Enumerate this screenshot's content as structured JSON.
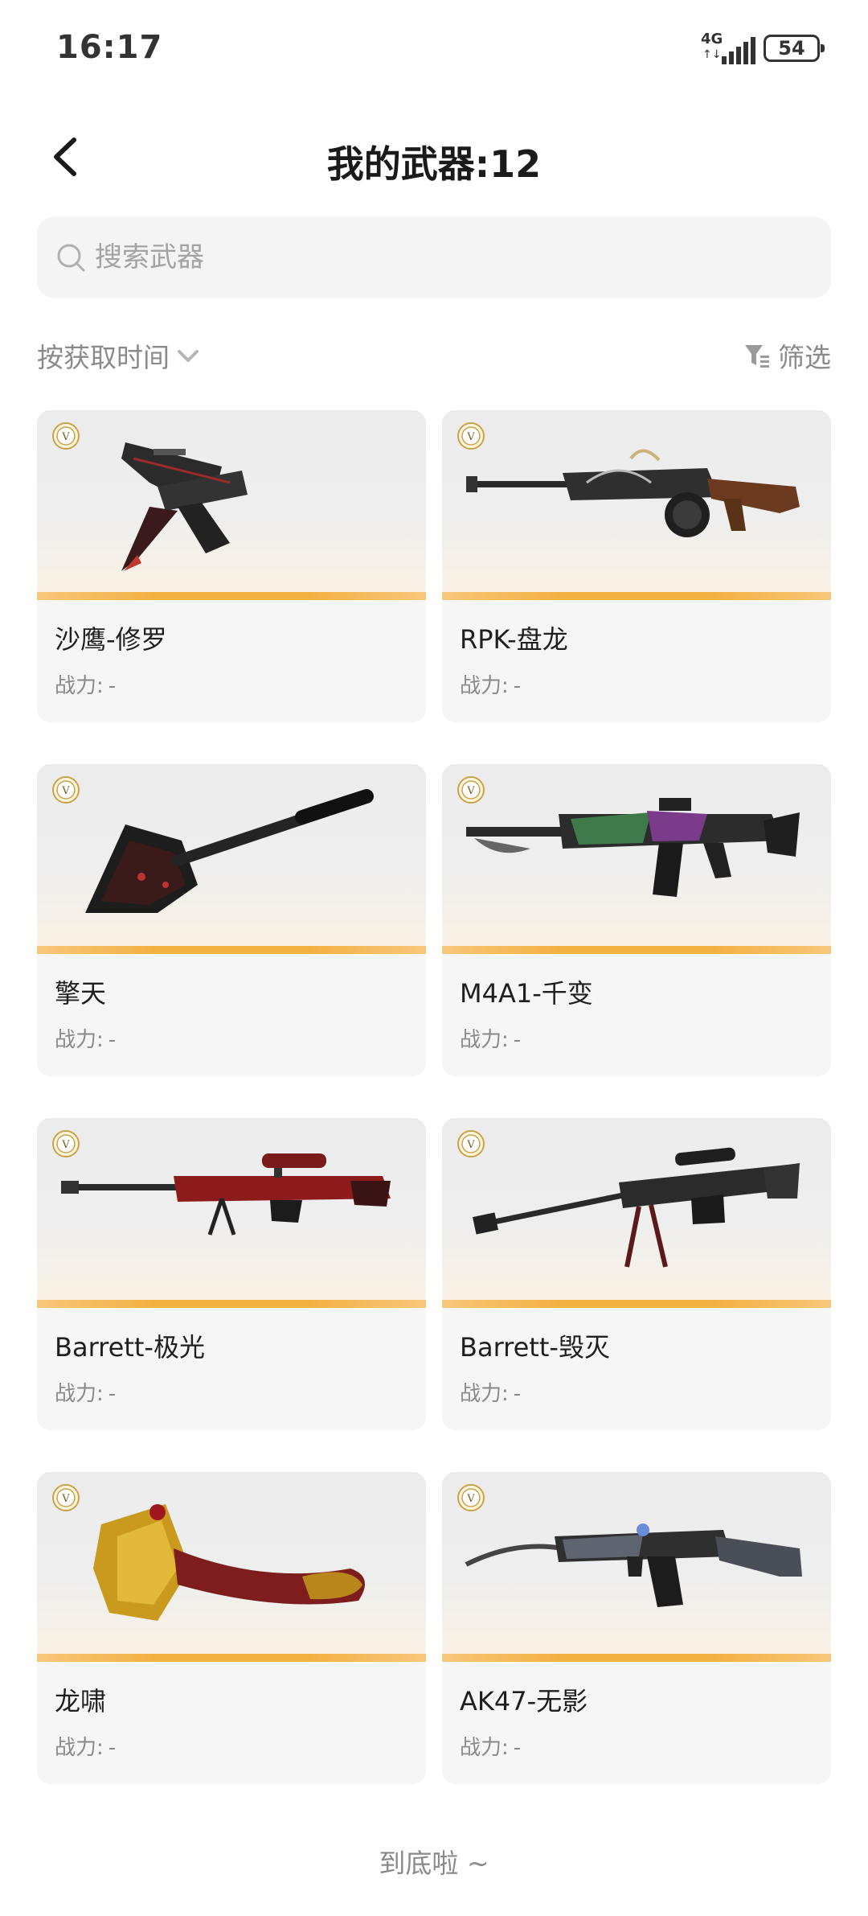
{
  "status_bar": {
    "time": "16:17",
    "network": "4G",
    "battery": "54"
  },
  "header": {
    "title": "我的武器:12"
  },
  "search": {
    "placeholder": "搜索武器"
  },
  "toolbar": {
    "sort_label": "按获取时间",
    "filter_label": "筛选"
  },
  "weapons": [
    {
      "name": "沙鹰-修罗",
      "power_label": "战力:",
      "power_value": "-",
      "icon": "pistol-icon"
    },
    {
      "name": "RPK-盘龙",
      "power_label": "战力:",
      "power_value": "-",
      "icon": "machine-gun-icon"
    },
    {
      "name": "擎天",
      "power_label": "战力:",
      "power_value": "-",
      "icon": "shovel-icon"
    },
    {
      "name": "M4A1-千变",
      "power_label": "战力:",
      "power_value": "-",
      "icon": "rifle-icon"
    },
    {
      "name": "Barrett-极光",
      "power_label": "战力:",
      "power_value": "-",
      "icon": "sniper-rifle-icon"
    },
    {
      "name": "Barrett-毁灭",
      "power_label": "战力:",
      "power_value": "-",
      "icon": "sniper-rifle-icon"
    },
    {
      "name": "龙啸",
      "power_label": "战力:",
      "power_value": "-",
      "icon": "axe-icon"
    },
    {
      "name": "AK47-无影",
      "power_label": "战力:",
      "power_value": "-",
      "icon": "assault-rifle-icon"
    }
  ],
  "footer": {
    "end_text": "到底啦 ~"
  },
  "colors": {
    "accent_stripe": "#f3b142",
    "card_bg": "#f6f6f6",
    "badge_gold": "#c9a24a"
  }
}
